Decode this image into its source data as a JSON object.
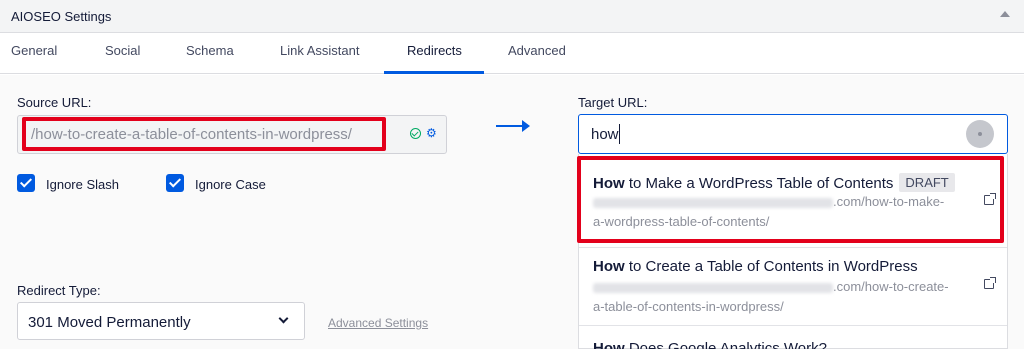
{
  "panel": {
    "title": "AIOSEO Settings"
  },
  "tabs": [
    {
      "label": "General"
    },
    {
      "label": "Social"
    },
    {
      "label": "Schema"
    },
    {
      "label": "Link Assistant"
    },
    {
      "label": "Redirects"
    },
    {
      "label": "Advanced"
    }
  ],
  "active_tab": "Redirects",
  "source": {
    "label": "Source URL:",
    "value": "/how-to-create-a-table-of-contents-in-wordpress/"
  },
  "options": {
    "ignore_slash": {
      "label": "Ignore Slash",
      "checked": true
    },
    "ignore_case": {
      "label": "Ignore Case",
      "checked": true
    }
  },
  "target": {
    "label": "Target URL:",
    "value": "how"
  },
  "results": [
    {
      "title_bold": "How",
      "title_rest": " to Make a WordPress Table of Contents",
      "badge": "DRAFT",
      "url_tail_1": ".com/how-to-make-",
      "url_tail_2": "a-wordpress-table-of-contents/"
    },
    {
      "title_bold": "How",
      "title_rest": " to Create a Table of Contents in WordPress",
      "url_tail_1": ".com/how-to-create-",
      "url_tail_2": "a-table-of-contents-in-wordpress/"
    },
    {
      "title_bold": "How",
      "title_rest": " Does Google Analytics Work?"
    }
  ],
  "redirect_type": {
    "label": "Redirect Type:",
    "value": "301 Moved Permanently"
  },
  "advanced_link": "Advanced Settings",
  "colors": {
    "accent": "#005ae0",
    "highlight": "#e3001b",
    "success": "#00aa63"
  }
}
